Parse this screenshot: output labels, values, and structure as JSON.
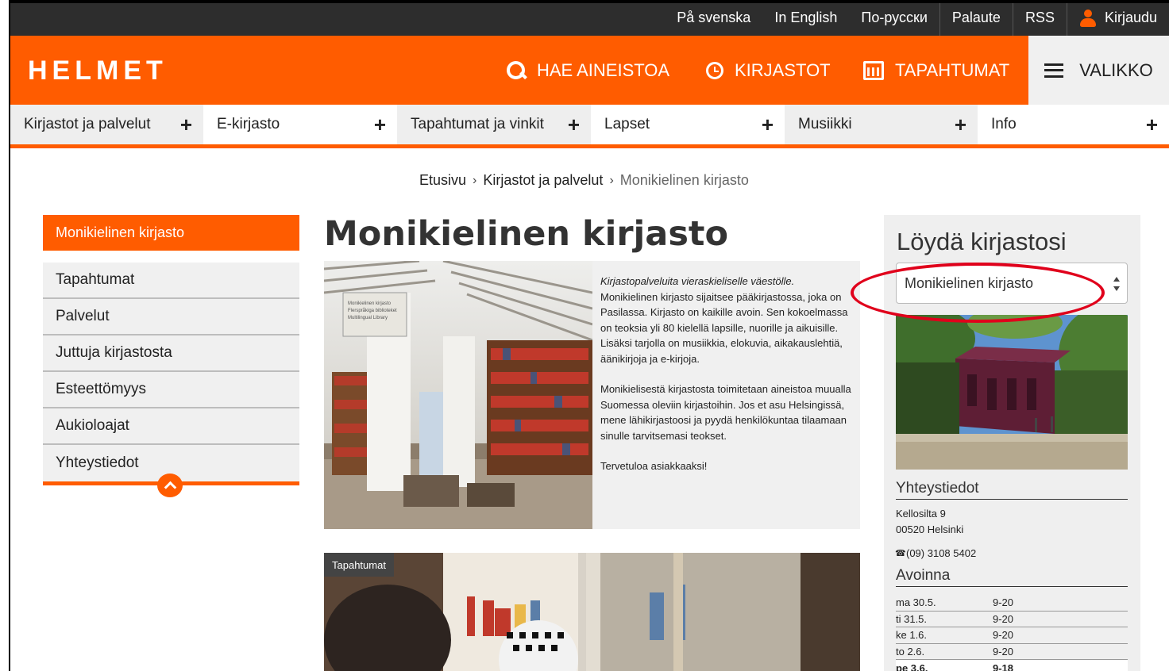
{
  "topbar": {
    "links": [
      "På svenska",
      "In English",
      "По-русски",
      "Palaute",
      "RSS"
    ],
    "login_label": "Kirjaudu"
  },
  "header": {
    "logo": "HELMET",
    "search_label": "HAE AINEISTOA",
    "libraries_label": "KIRJASTOT",
    "events_label": "TAPAHTUMAT",
    "menu_label": "VALIKKO",
    "accent_color": "#ff5c00"
  },
  "categories": [
    "Kirjastot ja palvelut",
    "E-kirjasto",
    "Tapahtumat ja vinkit",
    "Lapset",
    "Musiikki",
    "Info"
  ],
  "breadcrumb": {
    "home": "Etusivu",
    "parent": "Kirjastot ja palvelut",
    "current": "Monikielinen kirjasto",
    "separator": "›"
  },
  "sidebar": {
    "active": "Monikielinen kirjasto",
    "items": [
      "Tapahtumat",
      "Palvelut",
      "Juttuja kirjastosta",
      "Esteettömyys",
      "Aukioloajat",
      "Yhteystiedot"
    ]
  },
  "main": {
    "title": "Monikielinen kirjasto",
    "intro_italic": "Kirjastopalveluita vieraskieliselle väestölle.",
    "intro_p1": "Monikielinen kirjasto sijaitsee pääkirjastossa, joka on Pasilassa. Kirjasto on kaikille avoin. Sen kokoelmassa on teoksia yli 80 kielellä lapsille, nuorille ja aikuisille. Lisäksi tarjolla on musiikkia, elokuvia, aikakauslehtiä, äänikirjoja ja e-kirjoja.",
    "intro_p2": "Monikielisestä kirjastosta toimitetaan aineistoa muualla Suomessa oleviin kirjastoihin. Jos et asu Helsingissä, mene lähikirjastoosi ja pyydä henkilökuntaa tilaamaan sinulle tarvitsemasi teokset.",
    "intro_p3": "Tervetuloa asiakkaaksi!",
    "photo_sign": "Monikielinen kirjasto\nFlerspråkiga biblioteket\nMultilingual Library",
    "event_tag": "Tapahtumat"
  },
  "finder": {
    "title": "Löydä kirjastosi",
    "selected": "Monikielinen kirjasto",
    "contact_heading": "Yhteystiedot",
    "address_line1": "Kellosilta 9",
    "address_line2": "00520 Helsinki",
    "phone": "(09) 3108 5402",
    "hours_heading": "Avoinna",
    "hours": [
      {
        "day": "ma 30.5.",
        "time": "9-20"
      },
      {
        "day": "ti 31.5.",
        "time": "9-20"
      },
      {
        "day": "ke 1.6.",
        "time": "9-20"
      },
      {
        "day": "to 2.6.",
        "time": "9-20"
      },
      {
        "day": "pe 3.6.",
        "time": "9-18"
      }
    ]
  }
}
